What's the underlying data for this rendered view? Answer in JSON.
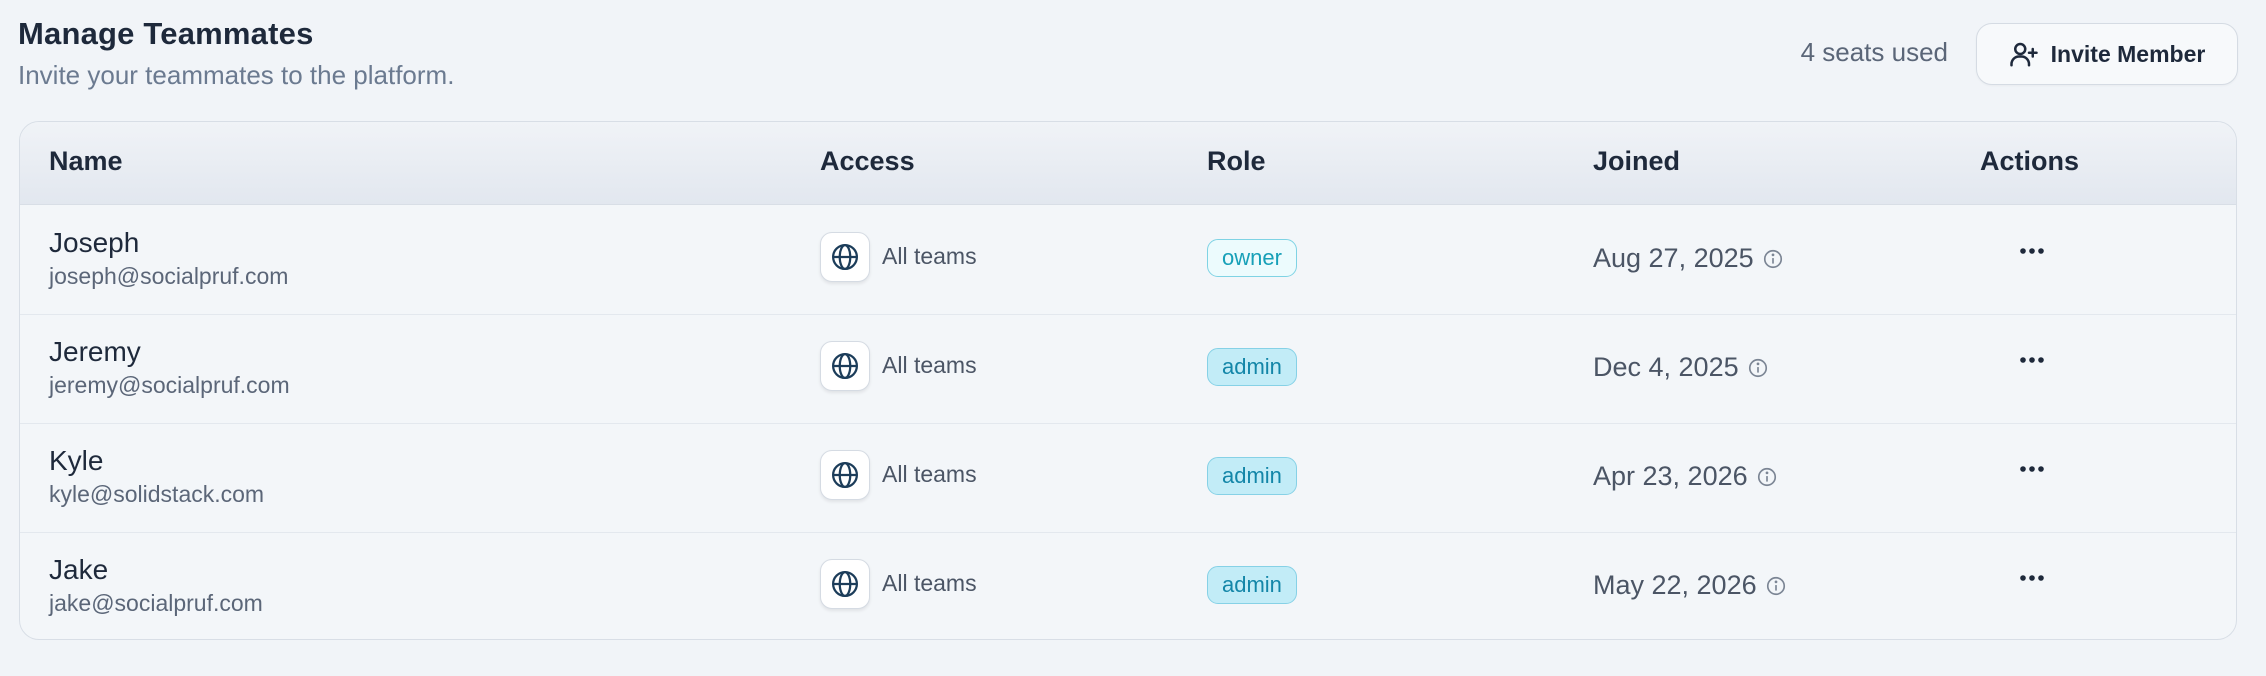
{
  "header": {
    "title": "Manage Teammates",
    "subtitle": "Invite your teammates to the platform.",
    "seats_used": "4 seats used",
    "invite_button": "Invite Member"
  },
  "table": {
    "columns": [
      "Name",
      "Access",
      "Role",
      "Joined",
      "Actions"
    ],
    "rows": [
      {
        "name": "Joseph",
        "email": "joseph@socialpruf.com",
        "access": "All teams",
        "role": "owner",
        "joined": "Aug 27, 2025"
      },
      {
        "name": "Jeremy",
        "email": "jeremy@socialpruf.com",
        "access": "All teams",
        "role": "admin",
        "joined": "Dec 4, 2025"
      },
      {
        "name": "Kyle",
        "email": "kyle@solidstack.com",
        "access": "All teams",
        "role": "admin",
        "joined": "Apr 23, 2026"
      },
      {
        "name": "Jake",
        "email": "jake@socialpruf.com",
        "access": "All teams",
        "role": "admin",
        "joined": "May 22, 2026"
      }
    ]
  },
  "icons": {
    "invite": "user-plus-icon",
    "access": "globe-icon",
    "joined_info": "info-icon",
    "actions": "more-horizontal-icon"
  },
  "colors": {
    "owner_text": "#17a0b8",
    "admin_badge": "#c2ecf7",
    "background": "#f1f4f8"
  }
}
